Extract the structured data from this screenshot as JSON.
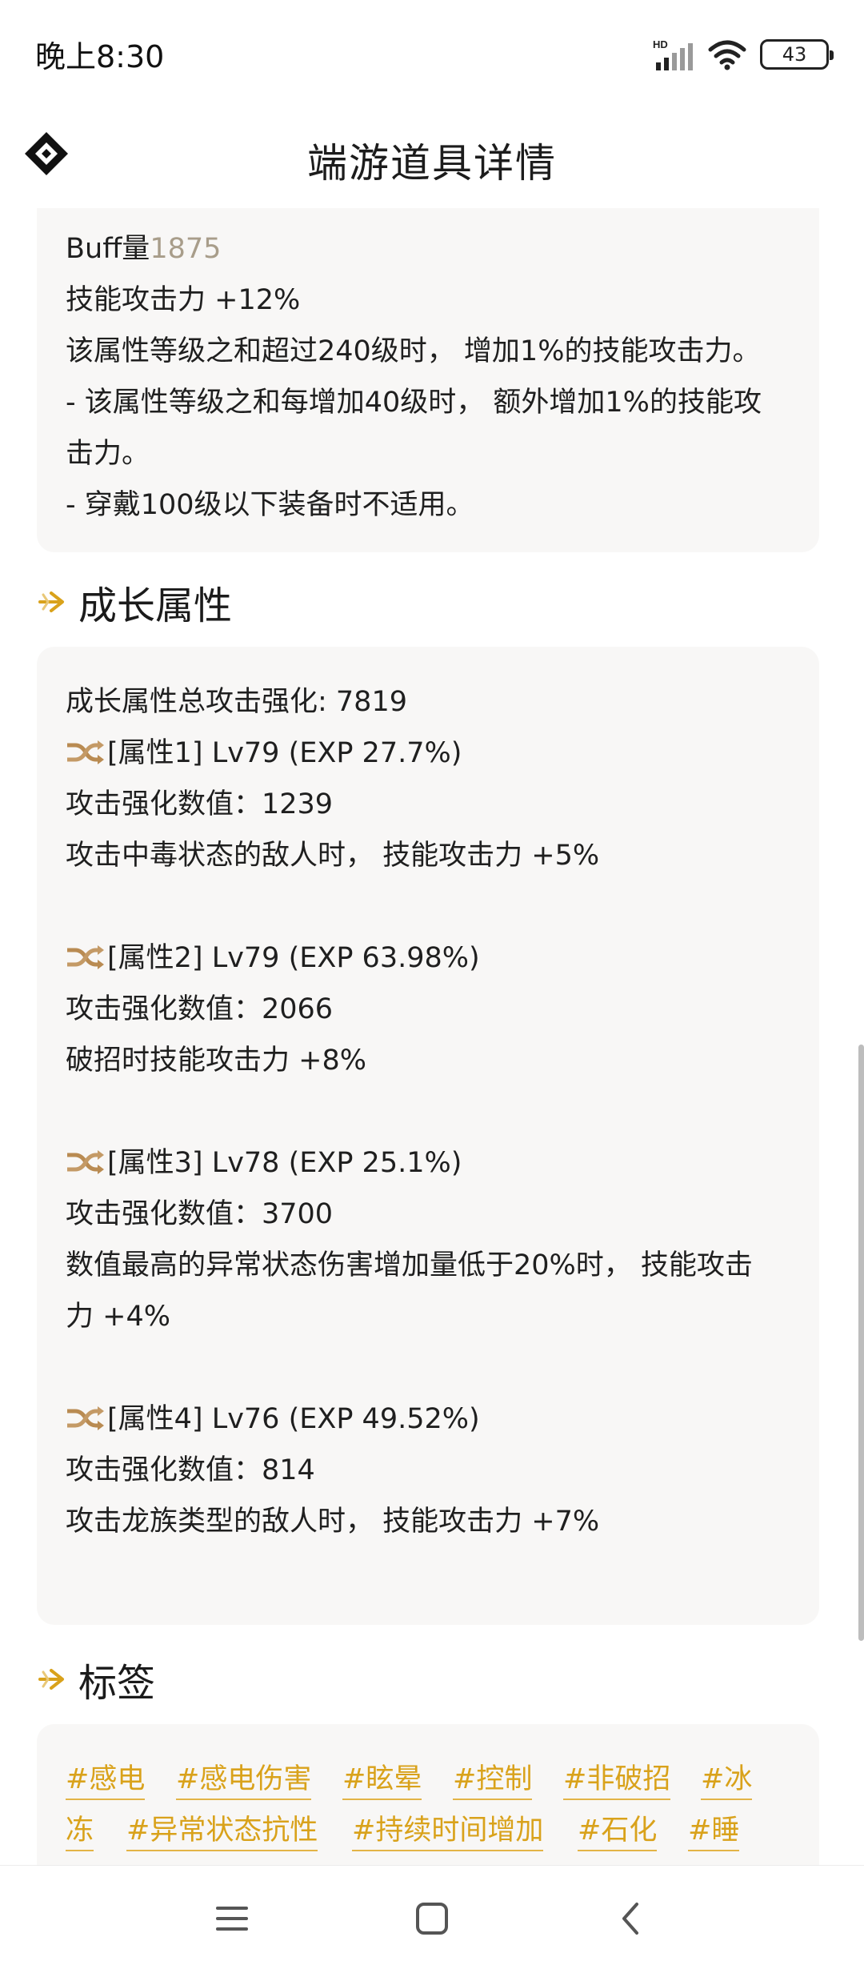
{
  "status_bar": {
    "time": "晚上8:30",
    "network_label": "HD",
    "battery": "43"
  },
  "header": {
    "title": "端游道具详情"
  },
  "buff_card": {
    "buff_label": "Buff量",
    "buff_value": "1875",
    "lines": [
      "技能攻击力 +12%",
      "该属性等级之和超过240级时， 增加1%的技能攻击力。",
      "- 该属性等级之和每增加40级时， 额外增加1%的技能攻",
      "击力。",
      "- 穿戴100级以下装备时不适用。"
    ]
  },
  "growth_section": {
    "title": "成长属性",
    "total": "成长属性总攻击强化: 7819",
    "attributes": [
      {
        "header": "[属性1] Lv79 (EXP 27.7%)",
        "value": "攻击强化数值：1239",
        "effect": [
          "攻击中毒状态的敌人时， 技能攻击力 +5%"
        ]
      },
      {
        "header": "[属性2] Lv79 (EXP 63.98%)",
        "value": "攻击强化数值：2066",
        "effect": [
          "破招时技能攻击力 +8%"
        ]
      },
      {
        "header": "[属性3] Lv78 (EXP 25.1%)",
        "value": "攻击强化数值：3700",
        "effect": [
          "数值最高的异常状态伤害增加量低于20%时， 技能攻击",
          "力 +4%"
        ]
      },
      {
        "header": "[属性4] Lv76 (EXP 49.52%)",
        "value": "攻击强化数值：814",
        "effect": [
          "攻击龙族类型的敌人时， 技能攻击力 +7%"
        ]
      }
    ]
  },
  "tags_section": {
    "title": "标签",
    "tags_row1": [
      "#感电",
      "#感电伤害",
      "#眩晕",
      "#控制",
      "#非破招",
      "#冰"
    ],
    "tags_row2": [
      "冻",
      "#异常状态抗性",
      "#持续时间增加",
      "#石化",
      "#睡"
    ]
  },
  "colors": {
    "accent": "#d9a21b",
    "card_bg": "#f8f7f6",
    "muted": "#a89d8a"
  },
  "icons": {
    "logo": "diamond-logo-icon",
    "section": "arrow-right-icon",
    "attribute": "shuffle-icon",
    "nav": [
      "menu-icon",
      "home-square-icon",
      "back-chevron-icon"
    ]
  }
}
